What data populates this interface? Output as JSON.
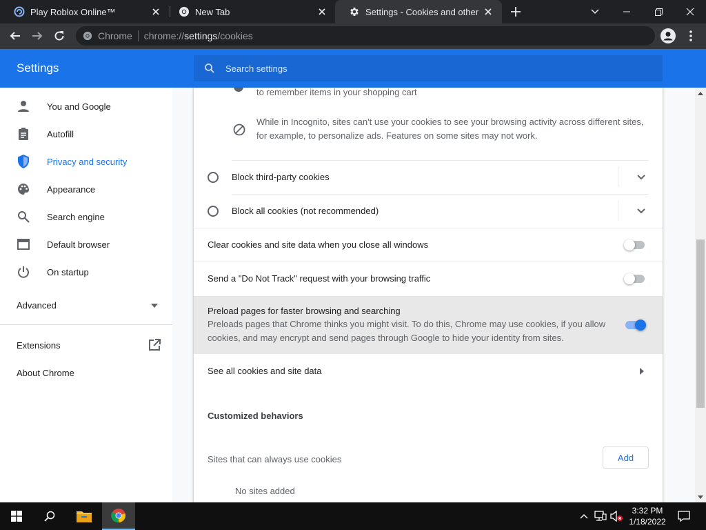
{
  "browser": {
    "tabs": [
      {
        "title": "Play Roblox Online™",
        "favicon": "roblox-icon",
        "active": false
      },
      {
        "title": "New Tab",
        "favicon": "chrome-icon",
        "active": false
      },
      {
        "title": "Settings - Cookies and other site",
        "favicon": "gear-icon",
        "active": true
      }
    ],
    "omnibox": {
      "chip_label": "Chrome",
      "url_scheme": "chrome://",
      "url_host": "settings",
      "url_path": "/cookies"
    }
  },
  "settings": {
    "title": "Settings",
    "search_placeholder": "Search settings"
  },
  "sidebar": {
    "items": [
      {
        "label": "You and Google",
        "icon": "person-icon"
      },
      {
        "label": "Autofill",
        "icon": "clipboard-icon"
      },
      {
        "label": "Privacy and security",
        "icon": "shield-icon",
        "selected": true
      },
      {
        "label": "Appearance",
        "icon": "palette-icon"
      },
      {
        "label": "Search engine",
        "icon": "search-icon"
      },
      {
        "label": "Default browser",
        "icon": "browser-window-icon"
      },
      {
        "label": "On startup",
        "icon": "power-icon"
      }
    ],
    "advanced_label": "Advanced",
    "extensions_label": "Extensions",
    "about_label": "About Chrome"
  },
  "cookies": {
    "partial_item_text": "to remember items in your shopping cart",
    "incognito_text_line1": "While in Incognito, sites can't use your cookies to see your browsing activity across different sites,",
    "incognito_text_line2": "for example, to personalize ads. Features on some sites may not work.",
    "block_third_party_label": "Block third-party cookies",
    "block_all_label": "Block all cookies (not recommended)",
    "clear_on_exit_label": "Clear cookies and site data when you close all windows",
    "clear_on_exit_enabled": false,
    "dnt_label": "Send a \"Do Not Track\" request with your browsing traffic",
    "dnt_enabled": false,
    "preload_label": "Preload pages for faster browsing and searching",
    "preload_sub_line1": "Preloads pages that Chrome thinks you might visit. To do this, Chrome may use cookies, if you allow",
    "preload_sub_line2": "cookies, and may encrypt and send pages through Google to hide your identity from sites.",
    "preload_enabled": true,
    "see_all_label": "See all cookies and site data",
    "customized_heading": "Customized behaviors",
    "always_allow_label": "Sites that can always use cookies",
    "add_button_label": "Add",
    "no_sites_label": "No sites added"
  },
  "taskbar": {
    "time": "3:32 PM",
    "date": "1/18/2022"
  },
  "colors": {
    "accent": "#1a73e8",
    "tab_strip": "#202124",
    "toolbar": "#35363a",
    "taskbar": "#101010"
  }
}
